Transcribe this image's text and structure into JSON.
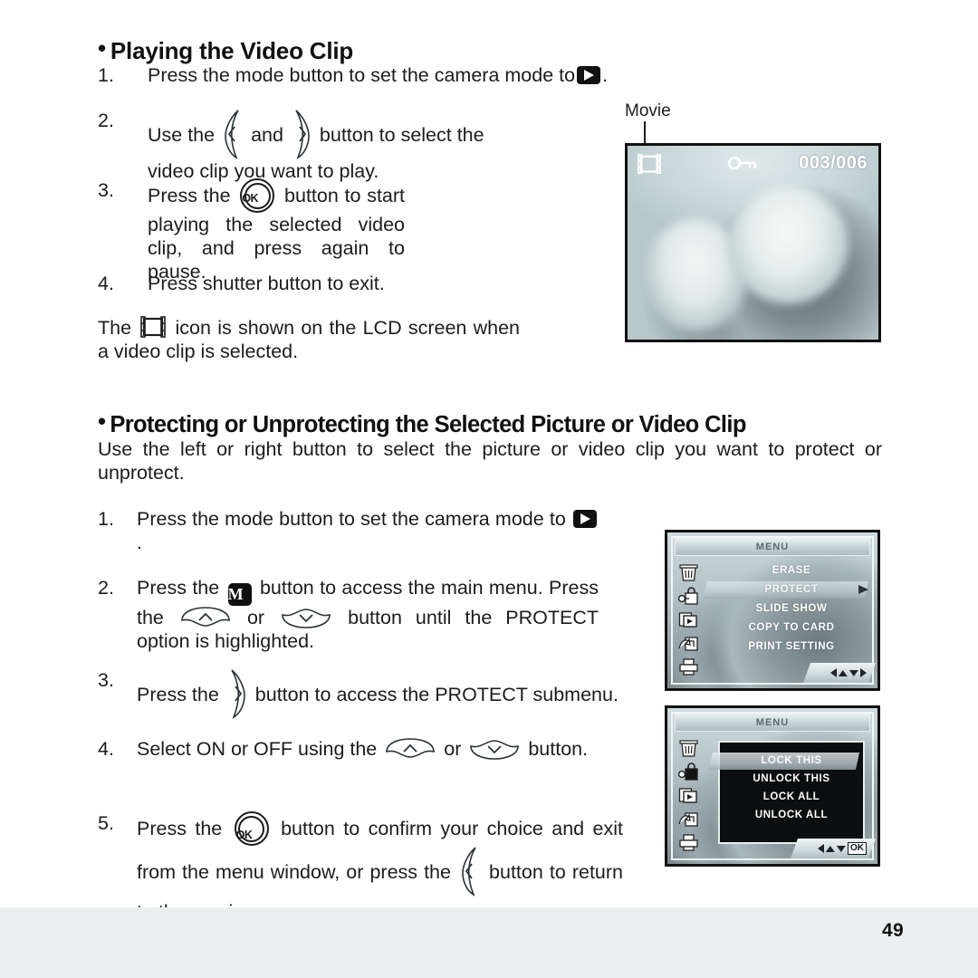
{
  "page": {
    "number": "49"
  },
  "section1": {
    "heading": "Playing the Video Clip",
    "steps": [
      {
        "num": "1.",
        "part1": "Press the mode button to set the camera mode to",
        "part2": "."
      },
      {
        "num": "2.",
        "part1": "Use the",
        "part2": "and",
        "part3": "button to select the video clip you want to play."
      },
      {
        "num": "3.",
        "part1": "Press the",
        "part2": "button to start playing the selected video clip, and press again to pause."
      },
      {
        "num": "4.",
        "part1": "Press shutter button to exit."
      }
    ],
    "note": {
      "part1": "The",
      "part2": "icon is shown on the LCD screen when a video clip is selected."
    }
  },
  "lcd_photo": {
    "callout_label": "Movie",
    "counter": "003/006",
    "icons": [
      "film-strip-icon",
      "key-protect-icon"
    ]
  },
  "section2": {
    "heading": "Protecting or Unprotecting the Selected Picture or Video Clip",
    "intro": "Use the left or right button to select the picture or video clip you want to protect or unprotect.",
    "steps": [
      {
        "num": "1.",
        "part1": "Press the mode button to set the camera mode to",
        "part2": "."
      },
      {
        "num": "2.",
        "part1": "Press the",
        "part2": "button to access the main menu. Press the",
        "part3": "or",
        "part4": "button until the PROTECT option is highlighted."
      },
      {
        "num": "3.",
        "part1": "Press the",
        "part2": "button to access the PROTECT submenu."
      },
      {
        "num": "4.",
        "part1": "Select ON or OFF using the",
        "part2": "or",
        "part3": "button."
      },
      {
        "num": "5.",
        "part1": "Press the",
        "part2": "button to confirm your choice and exit from the menu window, or press the",
        "part3": "button to return to the previous menu."
      }
    ]
  },
  "menu_main": {
    "title": "MENU",
    "sidebar_icons": [
      "trash-icon",
      "key-lock-icon",
      "slideshow-icon",
      "copy-to-card-icon",
      "printer-icon"
    ],
    "items": [
      {
        "label": "ERASE",
        "selected": false
      },
      {
        "label": "PROTECT",
        "selected": true
      },
      {
        "label": "SLIDE  SHOW",
        "selected": false
      },
      {
        "label": "COPY TO CARD",
        "selected": false
      },
      {
        "label": "PRINT SETTING",
        "selected": false
      }
    ],
    "nav_hint": [
      "left-arrow",
      "up-arrow",
      "down-arrow",
      "right-arrow"
    ]
  },
  "menu_sub": {
    "title": "MENU",
    "sidebar_icons": [
      "trash-icon",
      "key-lock-icon",
      "slideshow-icon",
      "copy-to-card-icon",
      "printer-icon"
    ],
    "items": [
      {
        "label": "LOCK THIS",
        "selected": true
      },
      {
        "label": "UNLOCK THIS",
        "selected": false
      },
      {
        "label": "LOCK ALL",
        "selected": false
      },
      {
        "label": "UNLOCK ALL",
        "selected": false
      }
    ],
    "nav_hint": [
      "left-arrow",
      "up-arrow",
      "down-arrow",
      "ok-label"
    ],
    "ok_label": "OK"
  }
}
